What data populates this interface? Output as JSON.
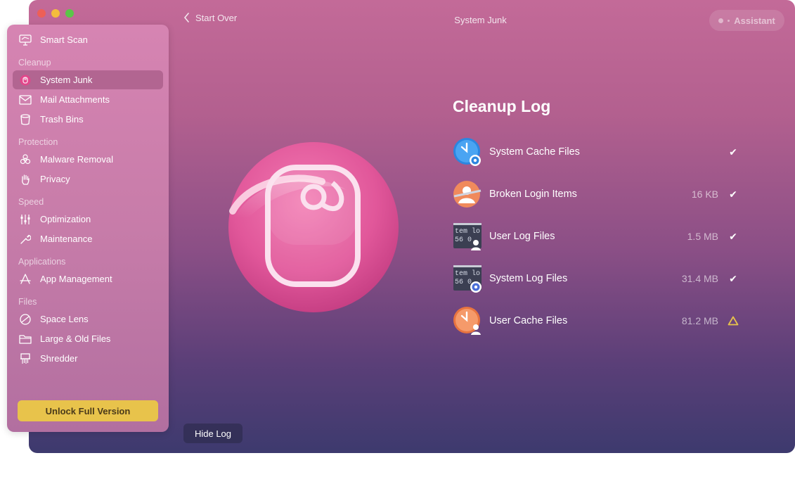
{
  "window": {
    "title": "System Junk",
    "back_label": "Start Over",
    "assistant_label": "Assistant"
  },
  "sidebar": {
    "top_item": {
      "label": "Smart Scan",
      "icon": "monitor-icon"
    },
    "sections": [
      {
        "title": "Cleanup",
        "items": [
          {
            "label": "System Junk",
            "icon": "system-junk-icon",
            "active": true
          },
          {
            "label": "Mail Attachments",
            "icon": "envelope-icon"
          },
          {
            "label": "Trash Bins",
            "icon": "trash-bin-icon"
          }
        ]
      },
      {
        "title": "Protection",
        "items": [
          {
            "label": "Malware Removal",
            "icon": "biohazard-icon"
          },
          {
            "label": "Privacy",
            "icon": "hand-icon"
          }
        ]
      },
      {
        "title": "Speed",
        "items": [
          {
            "label": "Optimization",
            "icon": "sliders-icon"
          },
          {
            "label": "Maintenance",
            "icon": "wrench-icon"
          }
        ]
      },
      {
        "title": "Applications",
        "items": [
          {
            "label": "App Management",
            "icon": "apps-icon"
          }
        ]
      },
      {
        "title": "Files",
        "items": [
          {
            "label": "Space Lens",
            "icon": "lens-icon"
          },
          {
            "label": "Large & Old Files",
            "icon": "folder-icon"
          },
          {
            "label": "Shredder",
            "icon": "shredder-icon"
          }
        ]
      }
    ],
    "unlock_label": "Unlock Full Version"
  },
  "cleanup_log": {
    "title": "Cleanup Log",
    "items": [
      {
        "name": "System Cache Files",
        "size": "",
        "status": "done",
        "icon": "clock-gear-icon"
      },
      {
        "name": "Broken Login Items",
        "size": "16 KB",
        "status": "done",
        "icon": "broken-login-icon"
      },
      {
        "name": "User Log Files",
        "size": "1.5 MB",
        "status": "done",
        "icon": "log-user-icon",
        "icon_text": [
          "tem lo",
          "56 0"
        ]
      },
      {
        "name": "System Log Files",
        "size": "31.4 MB",
        "status": "done",
        "icon": "log-gear-icon",
        "icon_text": [
          "tem lo",
          "56 0"
        ]
      },
      {
        "name": "User Cache Files",
        "size": "81.2 MB",
        "status": "warning",
        "icon": "clock-user-icon"
      }
    ]
  },
  "hide_log_label": "Hide Log",
  "colors": {
    "accent_pink": "#e4579a",
    "unlock_yellow": "#e8c34b",
    "warning": "#e8c34b",
    "check": "#ffffff"
  }
}
